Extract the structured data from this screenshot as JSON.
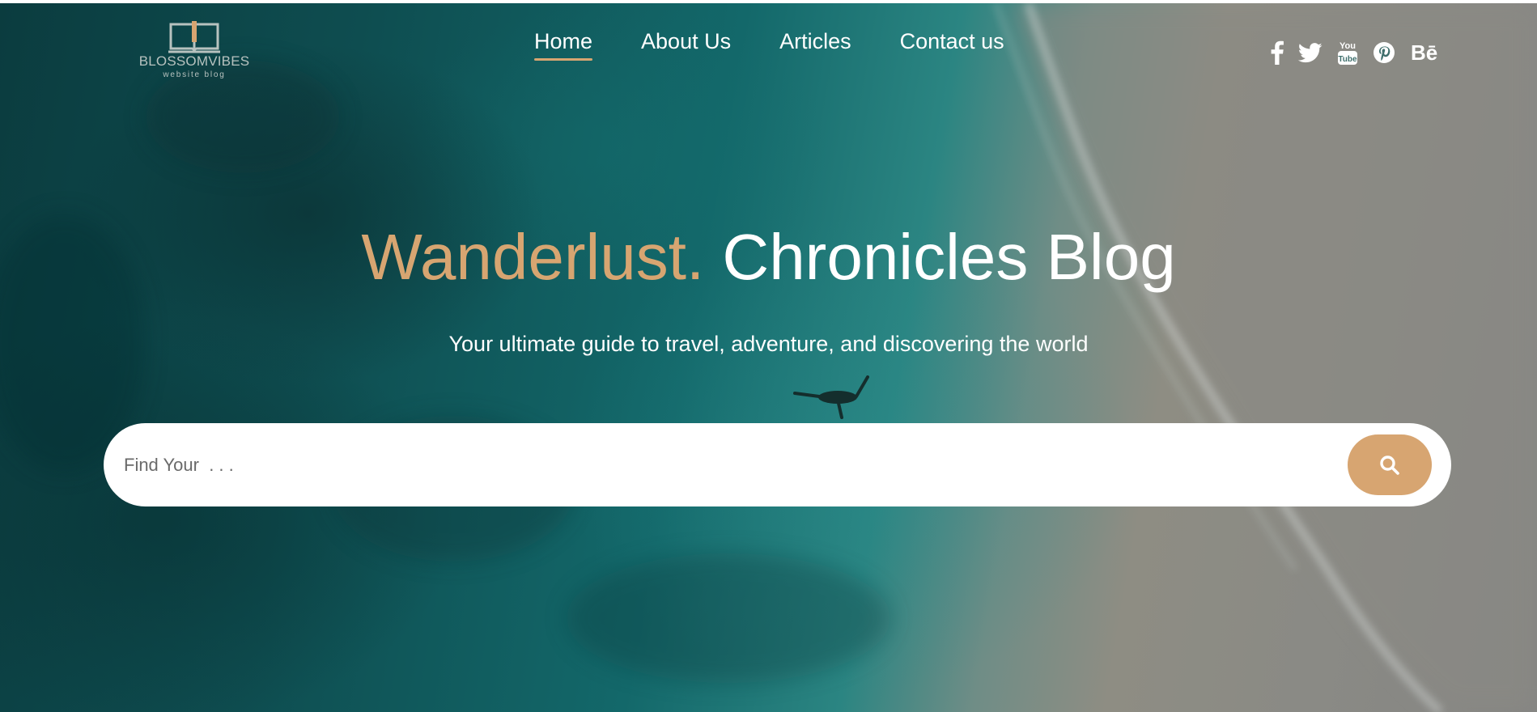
{
  "brand": {
    "name": "BLOSSOMVIBES",
    "tagline": "website blog",
    "logo_icon": "open-book-icon"
  },
  "nav": {
    "items": [
      {
        "label": "Home",
        "active": true
      },
      {
        "label": "About Us",
        "active": false
      },
      {
        "label": "Articles",
        "active": false
      },
      {
        "label": "Contact us",
        "active": false
      }
    ]
  },
  "social": {
    "icons": [
      "facebook-icon",
      "twitter-icon",
      "youtube-icon",
      "pinterest-icon",
      "behance-icon"
    ],
    "youtube_text_top": "You",
    "youtube_text_bottom": "Tube",
    "behance_text": "Bē"
  },
  "hero": {
    "title_accent": "Wanderlust.",
    "title_main": " Chronicles Blog",
    "subtitle": "Your ultimate guide to travel, adventure, and discovering the world"
  },
  "search": {
    "placeholder": "Find Your  . . .",
    "value": "",
    "button_icon": "search-icon"
  },
  "colors": {
    "accent": "#d7a571",
    "text_light": "#ffffff",
    "logo_text": "#b7c2bf"
  }
}
